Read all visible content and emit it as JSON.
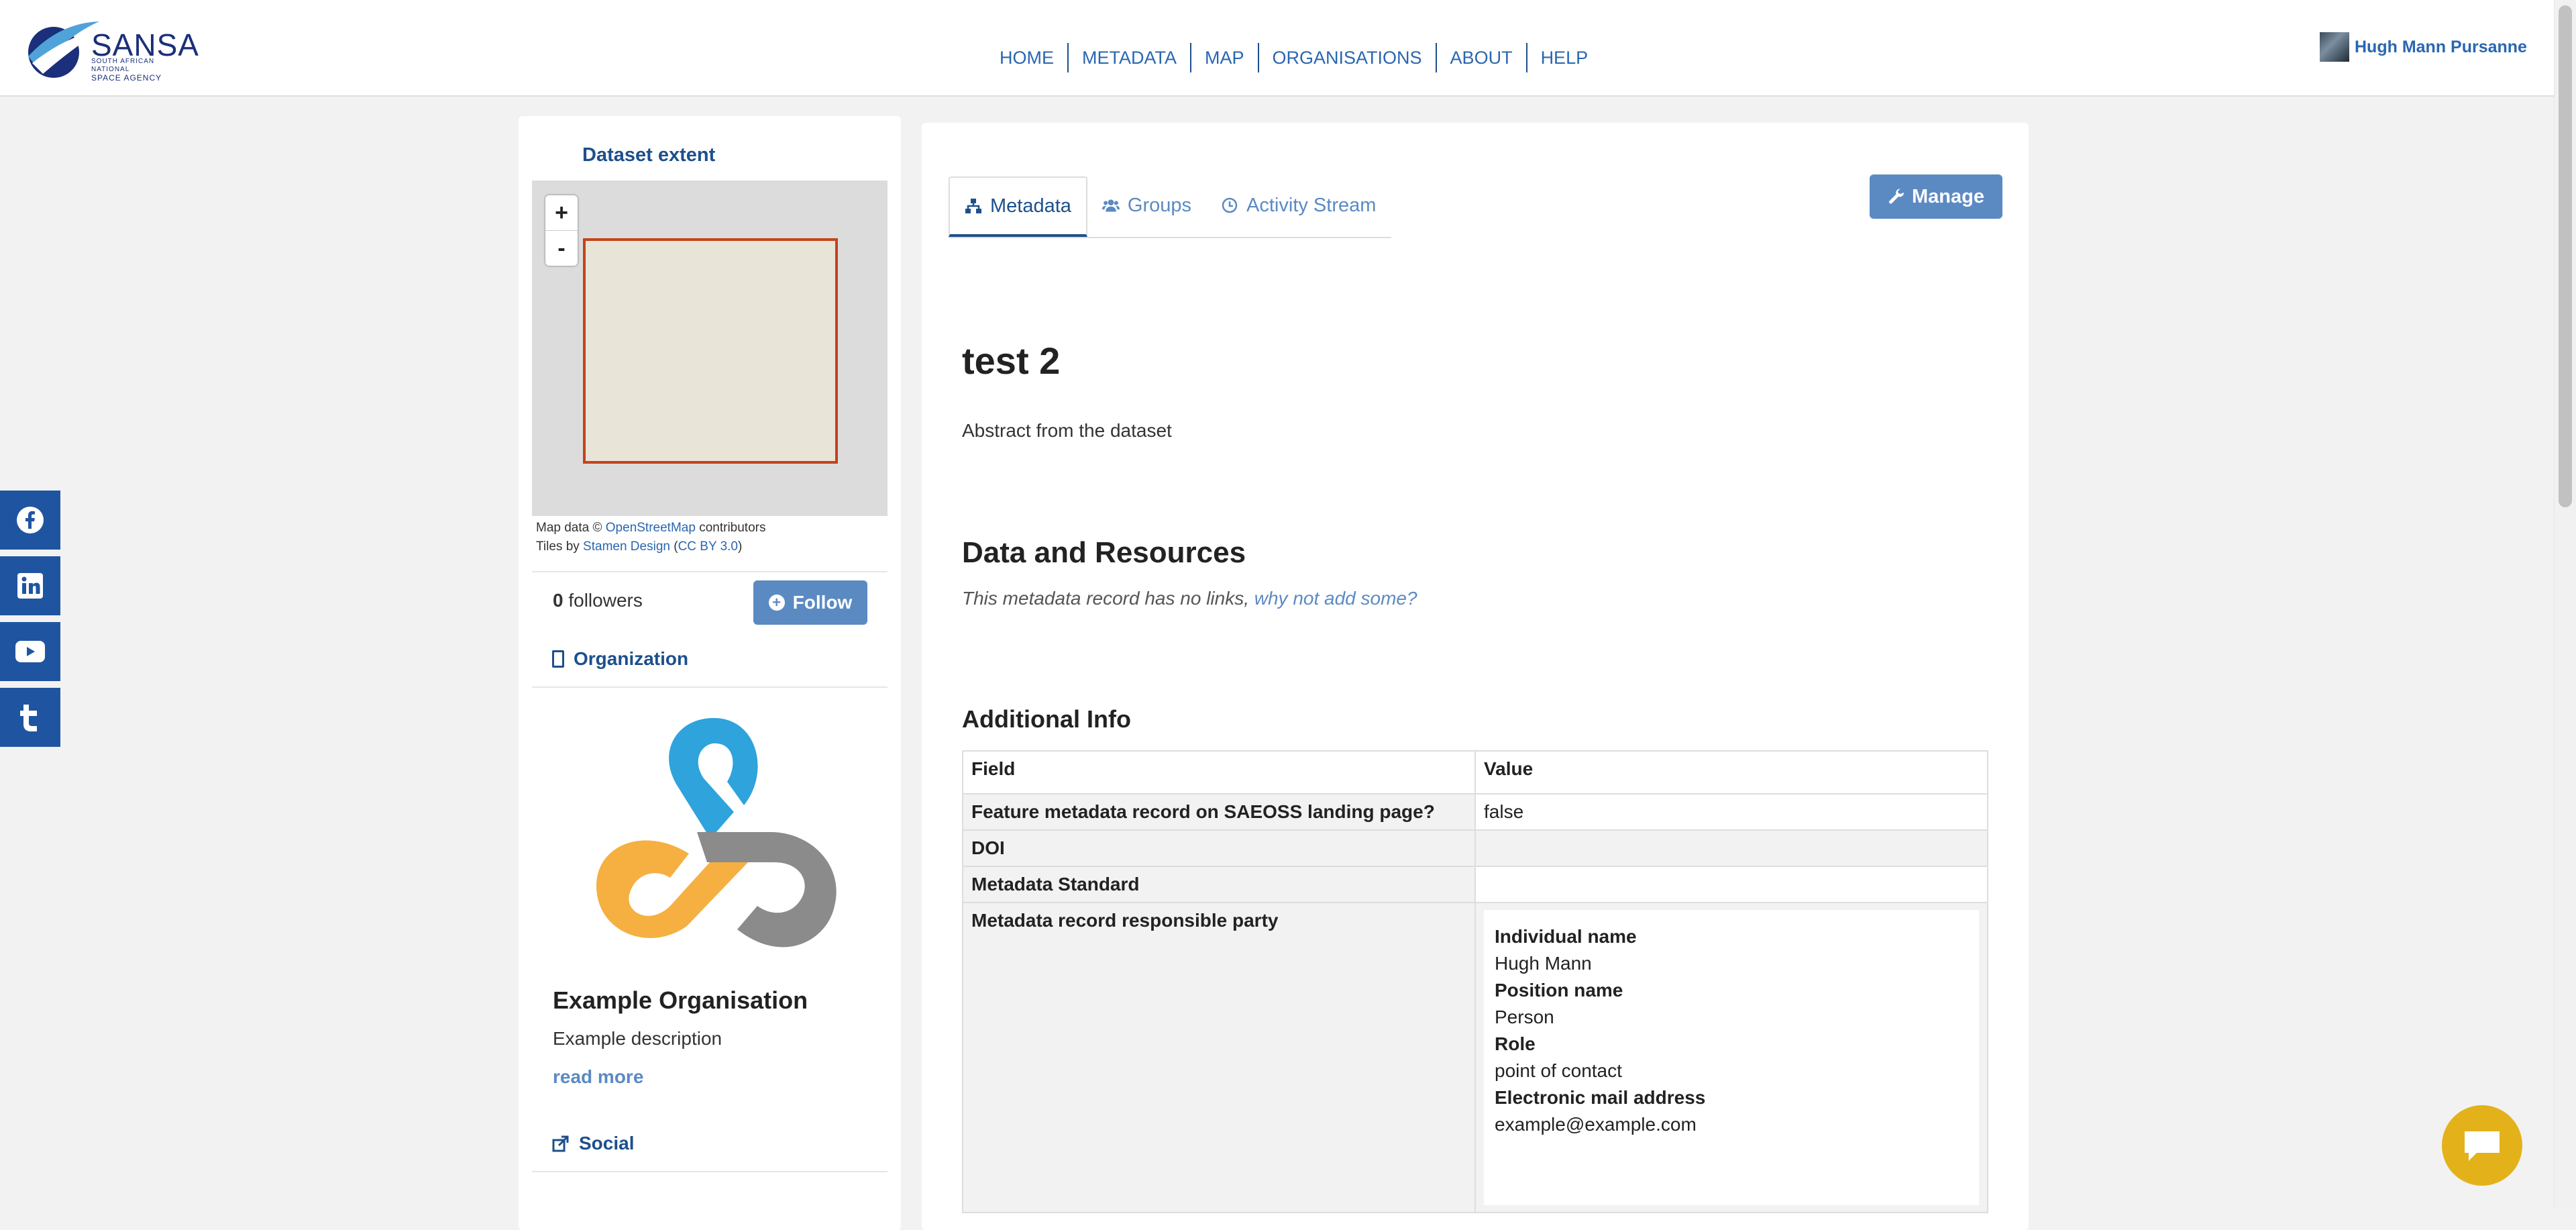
{
  "brand": {
    "name": "SANSA",
    "sub_line1": "SOUTH AFRICAN NATIONAL",
    "sub_line2": "SPACE AGENCY",
    "colors": {
      "primary": "#1d4f8c",
      "accent": "#5b8ac3",
      "link": "#2a66b0",
      "chat": "#e3b21a"
    }
  },
  "nav": {
    "items": [
      {
        "label": "HOME"
      },
      {
        "label": "METADATA"
      },
      {
        "label": "MAP"
      },
      {
        "label": "ORGANISATIONS"
      },
      {
        "label": "ABOUT"
      },
      {
        "label": "HELP"
      }
    ]
  },
  "user": {
    "name": "Hugh Mann Pursanne"
  },
  "social_rail": {
    "icons": [
      "facebook-icon",
      "linkedin-icon",
      "youtube-icon",
      "tumblr-icon"
    ]
  },
  "sidebar": {
    "extent_title": "Dataset extent",
    "map": {
      "zoom_in": "+",
      "zoom_out": "-",
      "attr_prefix": "Map data © ",
      "attr_osm": "OpenStreetMap",
      "attr_contrib": " contributors",
      "tiles_prefix": "Tiles by ",
      "tiles_stamen": "Stamen Design",
      "tiles_open": " (",
      "tiles_cc": "CC BY 3.0",
      "tiles_close": ")"
    },
    "followers_count": "0",
    "followers_label": "followers",
    "follow_label": "Follow",
    "organization_heading": "Organization",
    "org_name": "Example Organisation",
    "org_desc": "Example description",
    "read_more": "read more",
    "social_heading": "Social"
  },
  "main": {
    "tabs": [
      {
        "label": "Metadata",
        "icon": "sitemap-icon",
        "active": true
      },
      {
        "label": "Groups",
        "icon": "users-icon",
        "active": false
      },
      {
        "label": "Activity Stream",
        "icon": "clock-icon",
        "active": false
      }
    ],
    "manage_label": "Manage",
    "title": "test 2",
    "abstract": "Abstract from the dataset",
    "resources_heading": "Data and Resources",
    "no_links_text": "This metadata record has no links, ",
    "no_links_link": "why not add some?",
    "info_heading": "Additional Info",
    "table": {
      "headers": [
        "Field",
        "Value"
      ],
      "rows": [
        {
          "field": "Feature metadata record on SAEOSS landing page?",
          "value": "false"
        },
        {
          "field": "DOI",
          "value": ""
        },
        {
          "field": "Metadata Standard",
          "value": ""
        },
        {
          "field": "Metadata record responsible party",
          "value": ""
        }
      ],
      "party": {
        "individual_label": "Individual name",
        "individual_value": "Hugh Mann",
        "position_label": "Position name",
        "position_value": "Person",
        "role_label": "Role",
        "role_value": "point of contact",
        "email_label": "Electronic mail address",
        "email_value": "example@example.com"
      }
    }
  }
}
